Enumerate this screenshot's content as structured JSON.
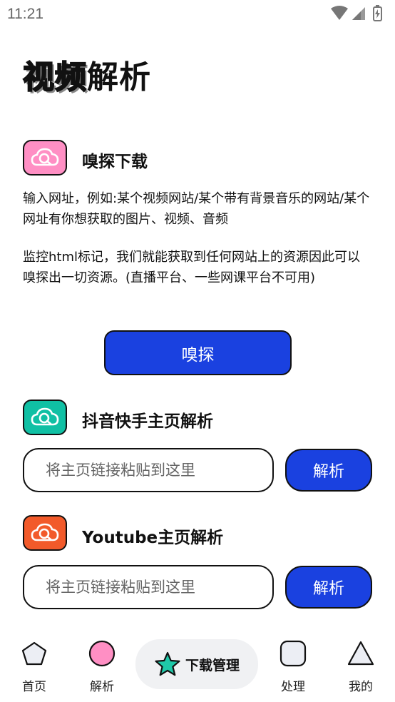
{
  "status_bar": {
    "time": "11:21"
  },
  "page": {
    "title_outline": "视频",
    "title_solid": "解析"
  },
  "sniff": {
    "title": "嗅探下载",
    "desc1": "输入网址，例如:某个视频网站/某个带有背景音乐的网站/某个网址有你想获取的图片、视频、音频",
    "desc2": "监控html标记，我们就能获取到任何网站上的资源因此可以嗅探出一切资源。(直播平台、一些网课平台不可用)",
    "button_label": "嗅探",
    "icon_color": "#f78fc0"
  },
  "douyin": {
    "title": "抖音快手主页解析",
    "placeholder": "将主页链接粘贴到这里",
    "button_label": "解析",
    "icon_color": "#10c0a4"
  },
  "youtube": {
    "title": "Youtube主页解析",
    "placeholder": "将主页链接粘贴到这里",
    "button_label": "解析",
    "icon_color": "#f25a2a"
  },
  "nav": {
    "home": "首页",
    "parse": "解析",
    "download": "下载管理",
    "process": "处理",
    "mine": "我的"
  },
  "colors": {
    "primary": "#1a41e0",
    "pink": "#ff8fc4",
    "teal": "#1fc8a8",
    "nav_grey": "#eceef4"
  }
}
